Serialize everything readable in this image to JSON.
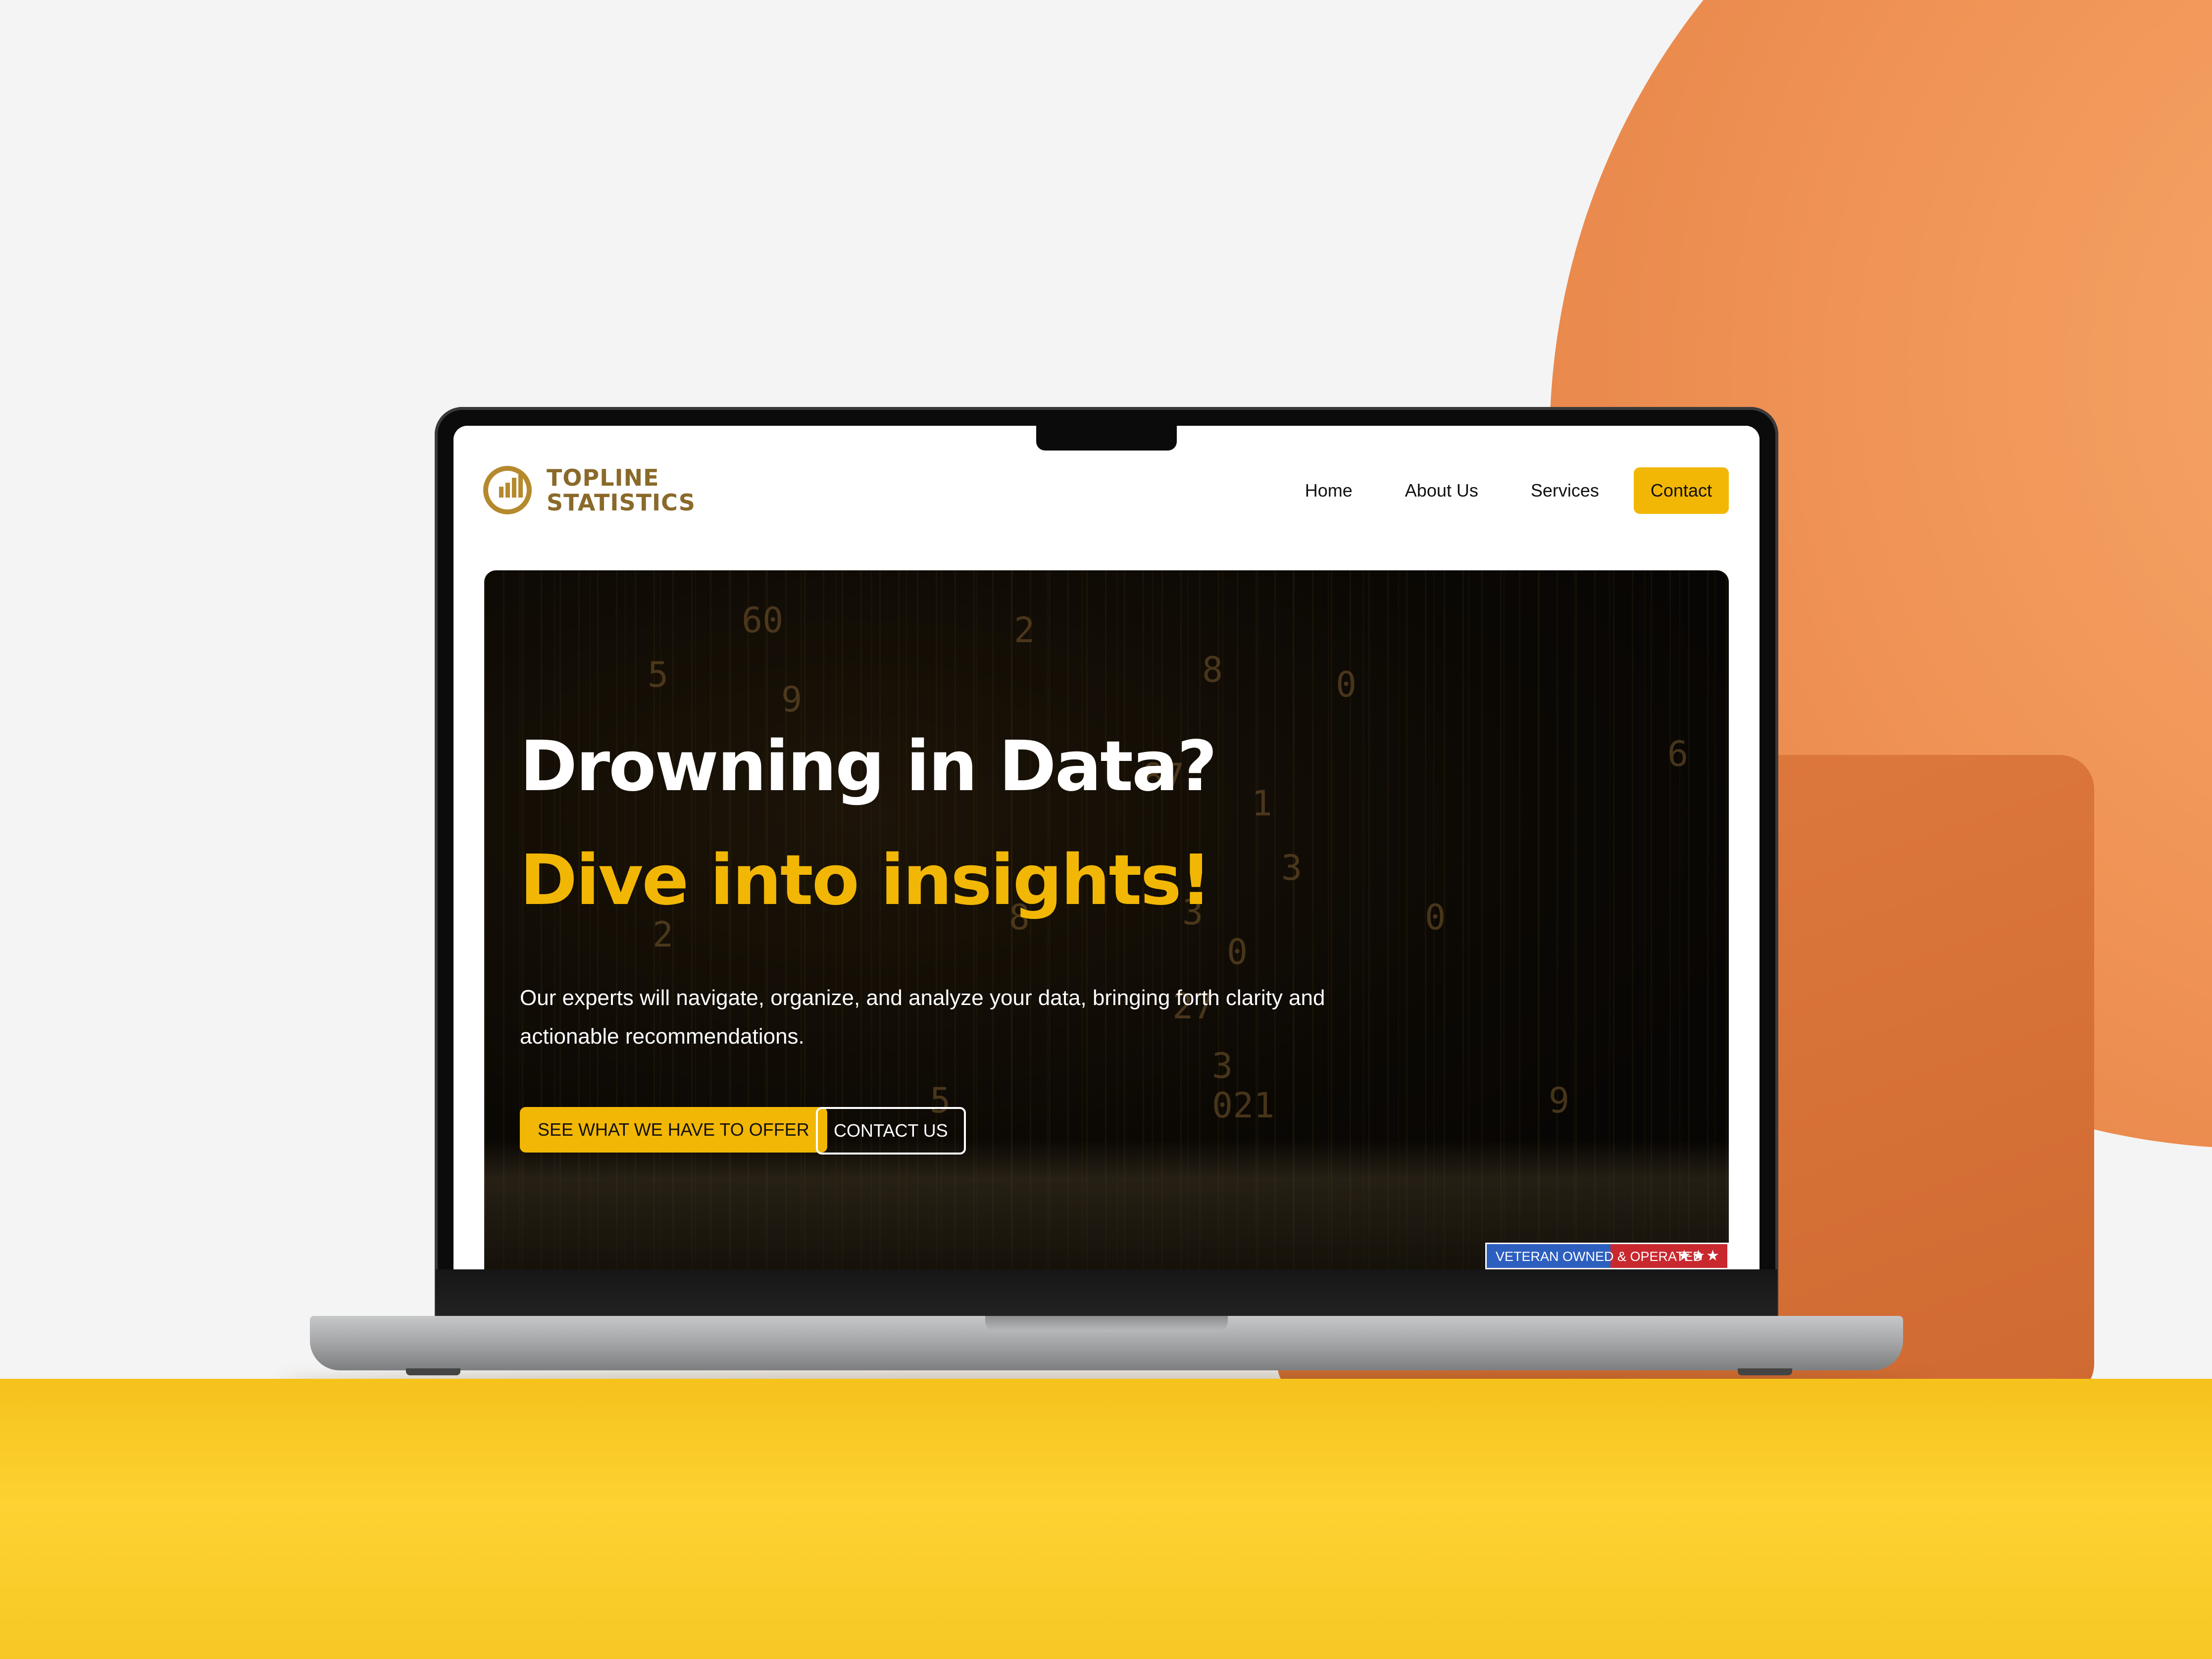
{
  "site": {
    "logo_line1": "TOPLINE",
    "logo_line2": "STATISTICS",
    "nav": {
      "home": "Home",
      "about": "About Us",
      "services": "Services",
      "contact": "Contact"
    }
  },
  "hero": {
    "title": "Drowning in Data?",
    "subtitle": "Dive into insights!",
    "description": "Our experts will navigate, organize, and analyze your data, bringing forth clarity and actionable recommendations.",
    "primary_button": "SEE WHAT WE HAVE TO OFFER",
    "secondary_button": "CONTACT US",
    "badge_text": "VETERAN OWNED & OPERATED",
    "badge_stars": "★★★",
    "background_digits": [
      "60",
      "2",
      "8",
      "0",
      "9",
      "5",
      "87",
      "1",
      "3",
      "2",
      "8",
      "3",
      "0",
      "27",
      "3",
      "021",
      "9",
      "6",
      "0",
      "5"
    ]
  },
  "colors": {
    "accent": "#f2b705",
    "logo_gold": "#b58a2e",
    "hero_bg": "#0b0804",
    "badge_blue": "#2d5fbf",
    "badge_red": "#c8282e"
  }
}
